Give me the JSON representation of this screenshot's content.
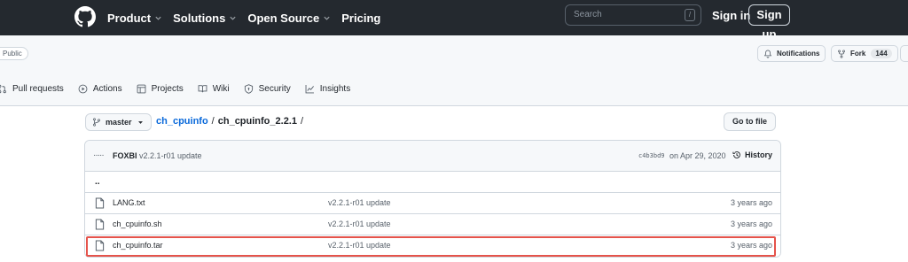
{
  "header": {
    "nav": [
      {
        "label": "Product",
        "has_menu": true
      },
      {
        "label": "Solutions",
        "has_menu": true
      },
      {
        "label": "Open Source",
        "has_menu": true
      },
      {
        "label": "Pricing",
        "has_menu": false
      }
    ],
    "search_placeholder": "Search",
    "search_shortcut": "/",
    "sign_in": "Sign in",
    "sign_up": "Sign up"
  },
  "repo": {
    "visibility": "Public",
    "notifications_label": "Notifications",
    "fork_label": "Fork",
    "fork_count": "144",
    "tabs": [
      {
        "label": "Pull requests",
        "icon": "pull-request-icon"
      },
      {
        "label": "Actions",
        "icon": "play-icon"
      },
      {
        "label": "Projects",
        "icon": "table-icon"
      },
      {
        "label": "Wiki",
        "icon": "book-icon"
      },
      {
        "label": "Security",
        "icon": "shield-icon"
      },
      {
        "label": "Insights",
        "icon": "graph-icon"
      }
    ]
  },
  "nav_bar": {
    "branch": "master",
    "repo_link": "ch_cpuinfo",
    "separator": "/",
    "current_dir": "ch_cpuinfo_2.2.1",
    "trailing_sep": "/",
    "goto_file": "Go to file"
  },
  "commit": {
    "dots": "·····",
    "author": "FOXBI",
    "message": "v2.2.1-r01 update",
    "hash": "c4b3bd9",
    "date": "on Apr 29, 2020",
    "history_label": "History"
  },
  "files": {
    "parent": "..",
    "rows": [
      {
        "name": "LANG.txt",
        "commit": "v2.2.1-r01 update",
        "age": "3 years ago"
      },
      {
        "name": "ch_cpuinfo.sh",
        "commit": "v2.2.1-r01 update",
        "age": "3 years ago"
      },
      {
        "name": "ch_cpuinfo.tar",
        "commit": "v2.2.1-r01 update",
        "age": "3 years ago"
      }
    ]
  },
  "colors": {
    "header_bg": "#24292f",
    "link": "#0969da",
    "highlight": "#e5534b"
  }
}
